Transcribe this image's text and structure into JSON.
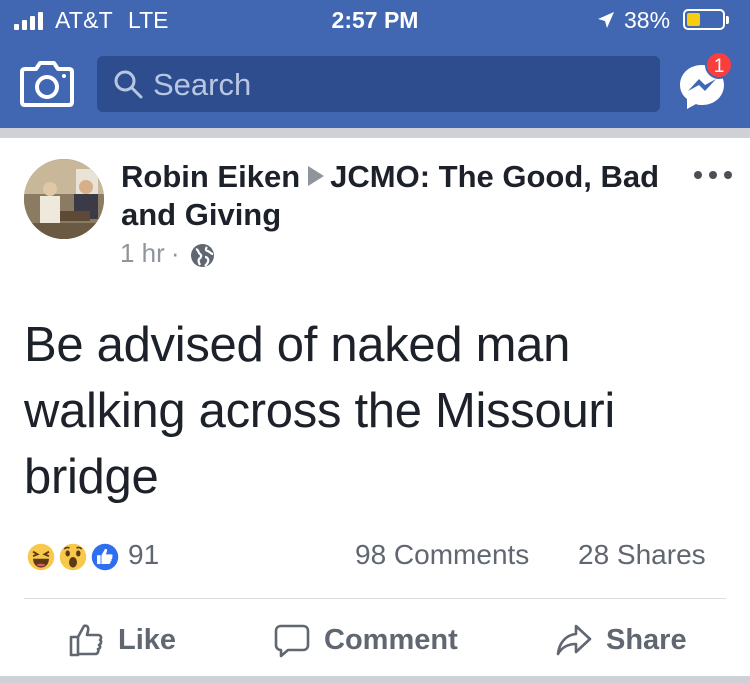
{
  "status_bar": {
    "carrier": "AT&T",
    "network": "LTE",
    "time": "2:57 PM",
    "battery_pct": "38%",
    "battery_level": 0.38,
    "icons": [
      "signal-icon",
      "location-arrow-icon",
      "battery-icon"
    ]
  },
  "nav": {
    "search_placeholder": "Search",
    "messenger_badge": "1",
    "icons": [
      "camera-icon",
      "search-icon",
      "messenger-icon"
    ]
  },
  "post": {
    "author": "Robin Eiken",
    "group": "JCMO: The Good, Bad and Giving",
    "time": "1 hr",
    "separator": "·",
    "privacy_icon": "globe-icon",
    "text": "Be advised of naked man walking across the Missouri bridge"
  },
  "engagement": {
    "reaction_icons": [
      "haha-icon",
      "wow-icon",
      "like-icon"
    ],
    "reaction_count": "91",
    "comments": "98 Comments",
    "shares": "28 Shares"
  },
  "actions": {
    "like": "Like",
    "comment": "Comment",
    "share": "Share"
  },
  "colors": {
    "brand_blue": "#4267b2",
    "search_bg": "#2d4d8f",
    "badge_red": "#fa3e3e",
    "text_primary": "#1d2129",
    "text_secondary": "#606770",
    "separator": "#cfd1d6"
  }
}
